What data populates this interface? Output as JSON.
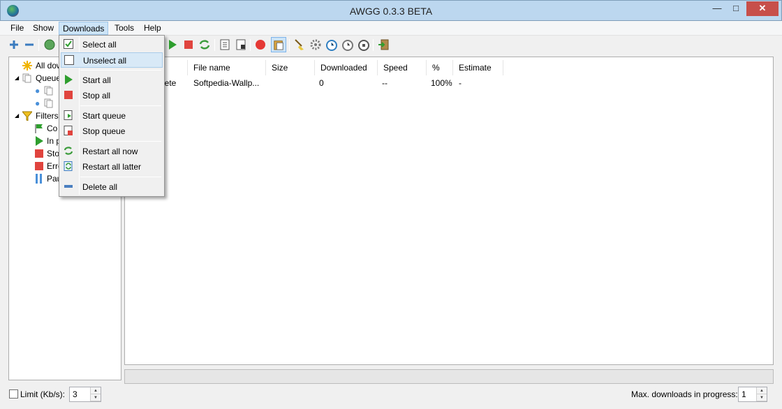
{
  "window": {
    "title": "AWGG 0.3.3 BETA",
    "minimize": "—",
    "maximize": "□",
    "close": "✕"
  },
  "menubar": {
    "file": "File",
    "show": "Show",
    "downloads": "Downloads",
    "tools": "Tools",
    "help": "Help"
  },
  "tree": {
    "all_downloads": "All dow",
    "queues": "Queue",
    "filters": "Filters",
    "completed": "Co",
    "in_progress": "In p",
    "stopped": "Sto",
    "error": "Erro",
    "paused": "Pau"
  },
  "table": {
    "columns": [
      "File name",
      "Size",
      "Downloaded",
      "Speed",
      "%",
      "Estimate"
    ],
    "rows": [
      {
        "status": "lete",
        "file_name": "Softpedia-Wallp...",
        "size": "",
        "downloaded": "0",
        "speed": "--",
        "percent": "100%",
        "estimate": "-"
      }
    ]
  },
  "statusbar": {
    "limit_label": "Limit (Kb/s):",
    "limit_value": "3",
    "max_label": "Max. downloads in progress:",
    "max_value": "1"
  },
  "downloads_menu": {
    "select_all": "Select all",
    "unselect_all": "Unselect all",
    "start_all": "Start all",
    "stop_all": "Stop all",
    "start_queue": "Start queue",
    "stop_queue": "Stop queue",
    "restart_all_now": "Restart all now",
    "restart_all_later": "Restart all latter",
    "delete_all": "Delete all"
  },
  "colors": {
    "titlebar": "#bcd7ef",
    "close": "#c74f4a",
    "play": "#2e9e2e",
    "stop": "#e0443e",
    "highlight": "#d8e9f7"
  }
}
